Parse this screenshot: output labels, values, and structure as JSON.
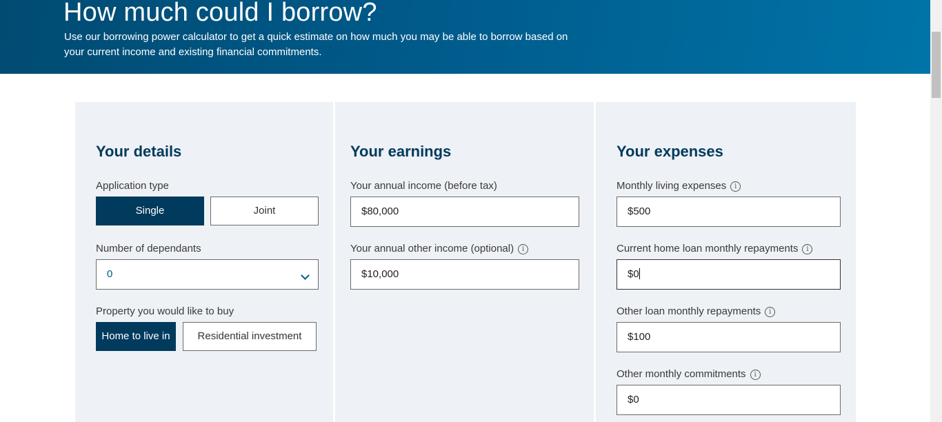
{
  "hero": {
    "title": "How much could I borrow?",
    "description": "Use our borrowing power calculator to get a quick estimate on how much you may be able to borrow based on your current income and existing financial commitments."
  },
  "details": {
    "heading": "Your details",
    "application_type_label": "Application type",
    "application_types": [
      "Single",
      "Joint"
    ],
    "application_type_selected": "Single",
    "dependants_label": "Number of dependants",
    "dependants_value": "0",
    "property_label": "Property you would like to buy",
    "property_options": [
      "Home to live in",
      "Residential investment"
    ],
    "property_selected": "Home to live in"
  },
  "earnings": {
    "heading": "Your earnings",
    "annual_income_label": "Your annual income (before tax)",
    "annual_income_value": "$80,000",
    "other_income_label": "Your annual other income (optional)",
    "other_income_value": "$10,000"
  },
  "expenses": {
    "heading": "Your expenses",
    "living_label": "Monthly living expenses",
    "living_value": "$500",
    "home_loan_label": "Current home loan monthly repayments",
    "home_loan_value": "$0",
    "other_loan_label": "Other loan monthly repayments",
    "other_loan_value": "$100",
    "commitments_label": "Other monthly commitments",
    "commitments_value": "$0"
  },
  "icons": {
    "info": "info-icon",
    "chevron": "chevron-down-icon"
  },
  "colors": {
    "brand_dark": "#003a5d",
    "hero_blue": "#005a8a",
    "panel_bg": "#eef1f5"
  }
}
